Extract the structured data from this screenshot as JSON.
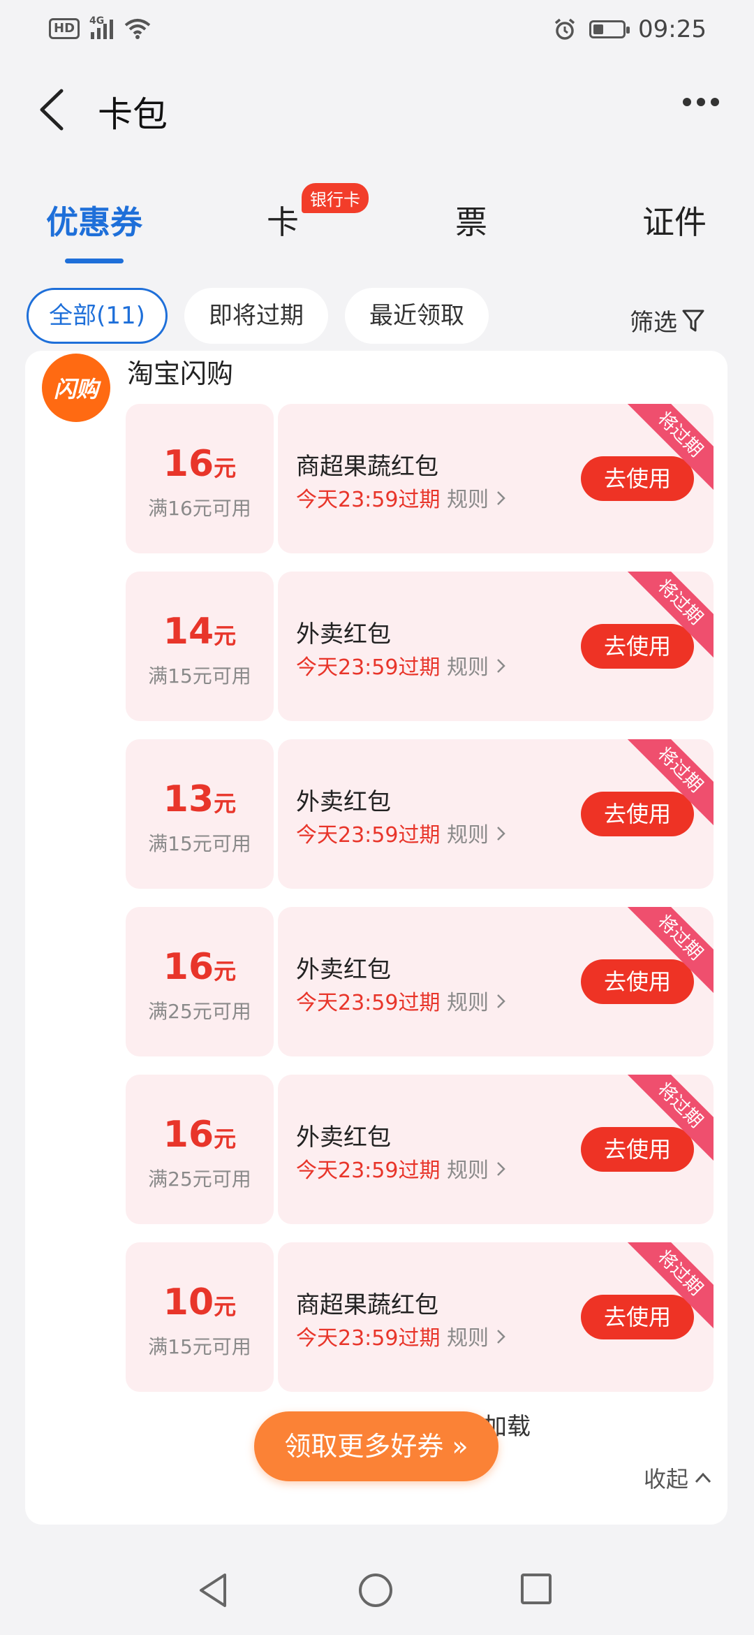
{
  "status_bar": {
    "hd": "HD",
    "network": "4G",
    "time": "09:25",
    "battery_level": 0.35
  },
  "header": {
    "title": "卡包"
  },
  "tabs": [
    {
      "label": "优惠券",
      "active": true
    },
    {
      "label": "卡",
      "badge": "银行卡"
    },
    {
      "label": "票"
    },
    {
      "label": "证件"
    }
  ],
  "filters": {
    "chips": [
      "全部(11)",
      "即将过期",
      "最近领取"
    ],
    "filter_label": "筛选"
  },
  "shop": {
    "logo_text": "闪购",
    "name": "淘宝闪购"
  },
  "coupons": [
    {
      "amount": "16",
      "unit": "元",
      "condition": "满16元可用",
      "name": "商超果蔬红包",
      "expire": "今天23:59过期",
      "rule": "规则",
      "button": "去使用",
      "ribbon": "将过期"
    },
    {
      "amount": "14",
      "unit": "元",
      "condition": "满15元可用",
      "name": "外卖红包",
      "expire": "今天23:59过期",
      "rule": "规则",
      "button": "去使用",
      "ribbon": "将过期"
    },
    {
      "amount": "13",
      "unit": "元",
      "condition": "满15元可用",
      "name": "外卖红包",
      "expire": "今天23:59过期",
      "rule": "规则",
      "button": "去使用",
      "ribbon": "将过期"
    },
    {
      "amount": "16",
      "unit": "元",
      "condition": "满25元可用",
      "name": "外卖红包",
      "expire": "今天23:59过期",
      "rule": "规则",
      "button": "去使用",
      "ribbon": "将过期"
    },
    {
      "amount": "16",
      "unit": "元",
      "condition": "满25元可用",
      "name": "外卖红包",
      "expire": "今天23:59过期",
      "rule": "规则",
      "button": "去使用",
      "ribbon": "将过期"
    },
    {
      "amount": "10",
      "unit": "元",
      "condition": "满15元可用",
      "name": "商超果蔬红包",
      "expire": "今天23:59过期",
      "rule": "规则",
      "button": "去使用",
      "ribbon": "将过期"
    }
  ],
  "footer": {
    "load_more": "点击继续加载",
    "collapse": "收起",
    "claim_button": "领取更多好券 »"
  }
}
